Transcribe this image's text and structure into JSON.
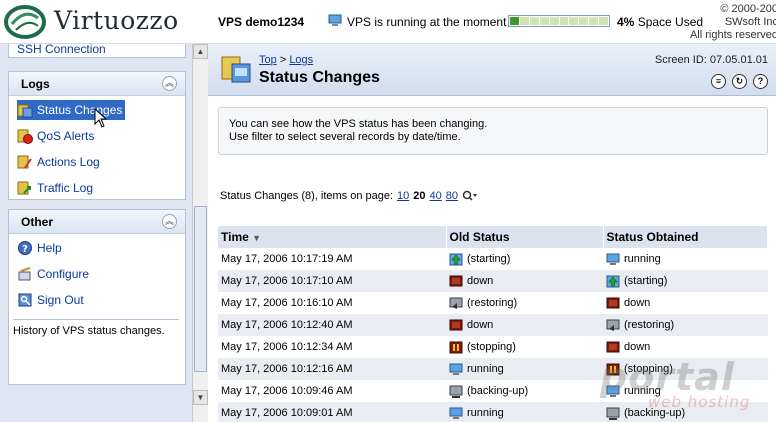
{
  "header": {
    "brand": "Virtuozzo",
    "vps_name": "VPS demo1234",
    "vps_status": "VPS is running at the moment",
    "space_percent": 4,
    "space_percent_label": "4%",
    "space_label": "Space Used",
    "copyright_line1": "© 2000-200",
    "copyright_line2": "SWsoft Inc",
    "copyright_line3": "All rights reserved"
  },
  "sidebar": {
    "top_item": "SSH Connection",
    "logs": {
      "title": "Logs",
      "items": [
        {
          "label": "Status Changes",
          "icon": "status-changes-icon"
        },
        {
          "label": "QoS Alerts",
          "icon": "qos-alerts-icon"
        },
        {
          "label": "Actions Log",
          "icon": "actions-log-icon"
        },
        {
          "label": "Traffic Log",
          "icon": "traffic-log-icon"
        }
      ]
    },
    "other": {
      "title": "Other",
      "items": [
        {
          "label": "Help",
          "icon": "help-icon"
        },
        {
          "label": "Configure",
          "icon": "configure-icon"
        },
        {
          "label": "Sign Out",
          "icon": "sign-out-icon"
        }
      ],
      "help_text": "History of VPS status changes."
    }
  },
  "main": {
    "breadcrumb_top": "Top",
    "breadcrumb_sep": ">",
    "breadcrumb_logs": "Logs",
    "title": "Status Changes",
    "screen_id": "Screen ID: 07.05.01.01",
    "info_line1": "You can see how the VPS status has been changing.",
    "info_line2": "Use filter to select several records by date/time.",
    "pager_label": "Status Changes (8), items on page:",
    "pager_options": [
      "10",
      "20",
      "40",
      "80"
    ],
    "pager_current": "20",
    "columns": [
      "Time",
      "Old Status",
      "Status Obtained"
    ],
    "rows": [
      {
        "time": "May 17, 2006 10:17:19 AM",
        "old": "(starting)",
        "new": "running"
      },
      {
        "time": "May 17, 2006 10:17:10 AM",
        "old": "down",
        "new": "(starting)"
      },
      {
        "time": "May 17, 2006 10:16:10 AM",
        "old": "(restoring)",
        "new": "down"
      },
      {
        "time": "May 17, 2006 10:12:40 AM",
        "old": "down",
        "new": "(restoring)"
      },
      {
        "time": "May 17, 2006 10:12:34 AM",
        "old": "(stopping)",
        "new": "down"
      },
      {
        "time": "May 17, 2006 10:12:16 AM",
        "old": "running",
        "new": "(stopping)"
      },
      {
        "time": "May 17, 2006 10:09:46 AM",
        "old": "(backing-up)",
        "new": "running"
      },
      {
        "time": "May 17, 2006 10:09:01 AM",
        "old": "running",
        "new": "(backing-up)"
      }
    ]
  },
  "watermark": {
    "line1": "portal",
    "line2": "web hosting"
  },
  "colors": {
    "accent": "#316ac5",
    "link": "#0b3a9b",
    "sidebar_bg": "#dfe6f2"
  }
}
